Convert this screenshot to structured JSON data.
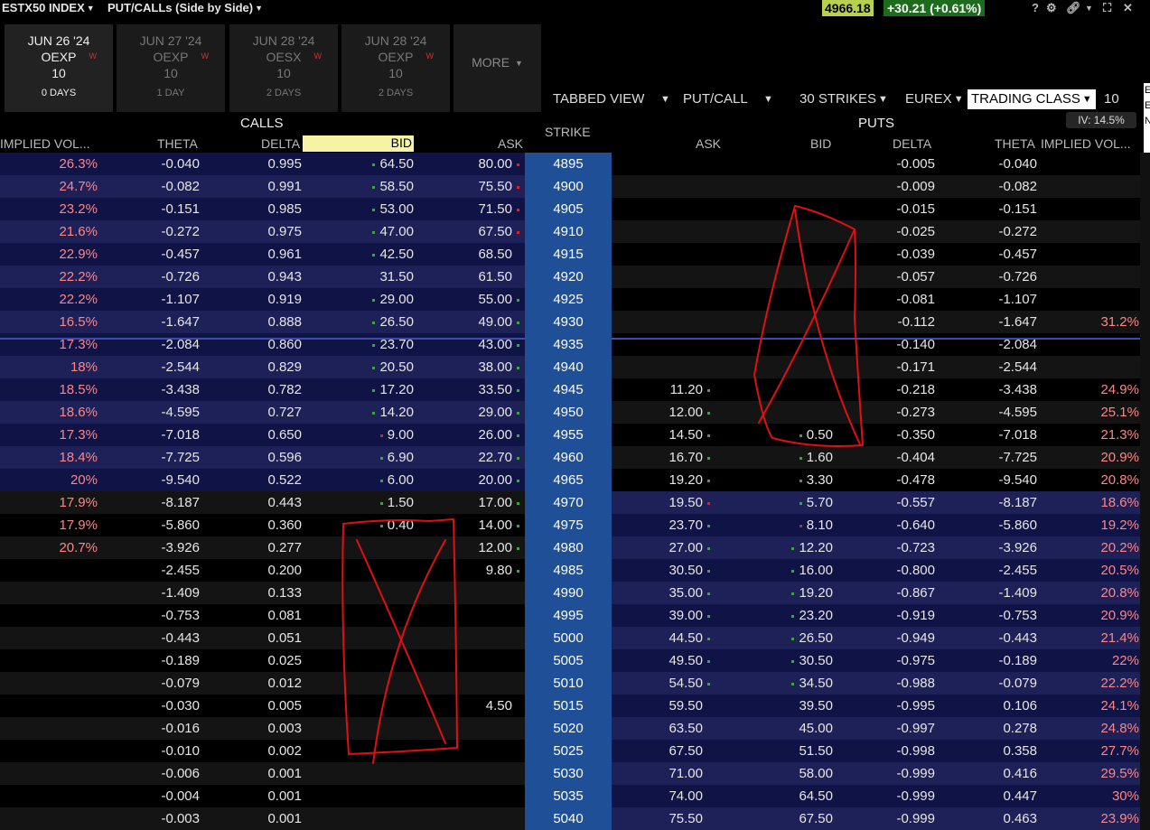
{
  "titlebar": {
    "symbol": "ESTX50 INDEX",
    "view": "PUT/CALLs (Side by Side)",
    "price": "4966.18",
    "change": "+30.21 (+0.61%)",
    "icons": [
      "help-icon",
      "gear-icon",
      "link-icon",
      "menu-caret-icon",
      "expand-icon",
      "close-icon"
    ]
  },
  "tabs": [
    {
      "date": "JUN 26 '24",
      "class": "OEXP",
      "mult": "10",
      "days": "0 DAYS",
      "flag": "W",
      "active": true
    },
    {
      "date": "JUN 27 '24",
      "class": "OEXP",
      "mult": "10",
      "days": "1 DAY",
      "flag": "W",
      "active": false
    },
    {
      "date": "JUN 28 '24",
      "class": "OESX",
      "mult": "10",
      "days": "2 DAYS",
      "flag": "W",
      "active": false
    },
    {
      "date": "JUN 28 '24",
      "class": "OEXP",
      "mult": "10",
      "days": "2 DAYS",
      "flag": "W",
      "active": false
    }
  ],
  "more_label": "MORE",
  "toolbar": {
    "view": "TABBED VIEW",
    "side": "PUT/CALL",
    "strikes": "30 STRIKES",
    "exchange": "EUREX",
    "trading_class": "TRADING CLASS",
    "multiplier": "10",
    "edge_text": "E E N"
  },
  "headers": {
    "calls": "CALLS",
    "puts": "PUTS",
    "strike": "STRIKE",
    "iv_badge": "IV: 14.5%",
    "call_cols": [
      "IMPLIED VOL...",
      "THETA",
      "DELTA",
      "BID",
      "ASK"
    ],
    "put_cols": [
      "ASK",
      "BID",
      "DELTA",
      "THETA",
      "IMPLIED VOL..."
    ]
  },
  "colors": {
    "strike_bg": "#1f4f97",
    "itm_call_a": "#101346",
    "itm_call_b": "#1d2158",
    "otm_a": "#000000",
    "otm_b": "#141414",
    "itm_put_a": "#101346",
    "itm_put_b": "#1d2158",
    "iv_text": "#ff8585",
    "annotation": "#e01010"
  },
  "rows": [
    {
      "strike": "4895",
      "c_iv": "26.3%",
      "c_theta": "-0.040",
      "c_delta": "0.995",
      "c_bid": "64.50",
      "c_bid_dot": "g",
      "c_ask": "80.00",
      "c_ask_dot": "r",
      "p_ask": "",
      "p_ask_dot": "",
      "p_bid": "",
      "p_bid_dot": "",
      "p_delta": "-0.005",
      "p_theta": "-0.040",
      "p_iv": ""
    },
    {
      "strike": "4900",
      "c_iv": "24.7%",
      "c_theta": "-0.082",
      "c_delta": "0.991",
      "c_bid": "58.50",
      "c_bid_dot": "g",
      "c_ask": "75.50",
      "c_ask_dot": "r",
      "p_ask": "",
      "p_ask_dot": "",
      "p_bid": "",
      "p_bid_dot": "",
      "p_delta": "-0.009",
      "p_theta": "-0.082",
      "p_iv": ""
    },
    {
      "strike": "4905",
      "c_iv": "23.2%",
      "c_theta": "-0.151",
      "c_delta": "0.985",
      "c_bid": "53.00",
      "c_bid_dot": "g",
      "c_ask": "71.50",
      "c_ask_dot": "r",
      "p_ask": "",
      "p_ask_dot": "",
      "p_bid": "",
      "p_bid_dot": "",
      "p_delta": "-0.015",
      "p_theta": "-0.151",
      "p_iv": ""
    },
    {
      "strike": "4910",
      "c_iv": "21.6%",
      "c_theta": "-0.272",
      "c_delta": "0.975",
      "c_bid": "47.00",
      "c_bid_dot": "g",
      "c_ask": "67.50",
      "c_ask_dot": "r",
      "p_ask": "",
      "p_ask_dot": "",
      "p_bid": "",
      "p_bid_dot": "",
      "p_delta": "-0.025",
      "p_theta": "-0.272",
      "p_iv": ""
    },
    {
      "strike": "4915",
      "c_iv": "22.9%",
      "c_theta": "-0.457",
      "c_delta": "0.961",
      "c_bid": "42.50",
      "c_bid_dot": "g",
      "c_ask": "68.50",
      "c_ask_dot": "",
      "p_ask": "",
      "p_ask_dot": "",
      "p_bid": "",
      "p_bid_dot": "",
      "p_delta": "-0.039",
      "p_theta": "-0.457",
      "p_iv": ""
    },
    {
      "strike": "4920",
      "c_iv": "22.2%",
      "c_theta": "-0.726",
      "c_delta": "0.943",
      "c_bid": "31.50",
      "c_bid_dot": "",
      "c_ask": "61.50",
      "c_ask_dot": "",
      "p_ask": "",
      "p_ask_dot": "",
      "p_bid": "",
      "p_bid_dot": "",
      "p_delta": "-0.057",
      "p_theta": "-0.726",
      "p_iv": ""
    },
    {
      "strike": "4925",
      "c_iv": "22.2%",
      "c_theta": "-1.107",
      "c_delta": "0.919",
      "c_bid": "29.00",
      "c_bid_dot": "g",
      "c_ask": "55.00",
      "c_ask_dot": "g",
      "p_ask": "",
      "p_ask_dot": "",
      "p_bid": "",
      "p_bid_dot": "",
      "p_delta": "-0.081",
      "p_theta": "-1.107",
      "p_iv": ""
    },
    {
      "strike": "4930",
      "c_iv": "16.5%",
      "c_theta": "-1.647",
      "c_delta": "0.888",
      "c_bid": "26.50",
      "c_bid_dot": "g",
      "c_ask": "49.00",
      "c_ask_dot": "g",
      "p_ask": "",
      "p_ask_dot": "",
      "p_bid": "",
      "p_bid_dot": "",
      "p_delta": "-0.112",
      "p_theta": "-1.647",
      "p_iv": "31.2%"
    },
    {
      "strike": "4935",
      "c_iv": "17.3%",
      "c_theta": "-2.084",
      "c_delta": "0.860",
      "c_bid": "23.70",
      "c_bid_dot": "g",
      "c_ask": "43.00",
      "c_ask_dot": "g",
      "p_ask": "",
      "p_ask_dot": "",
      "p_bid": "",
      "p_bid_dot": "",
      "p_delta": "-0.140",
      "p_theta": "-2.084",
      "p_iv": ""
    },
    {
      "strike": "4940",
      "c_iv": "18%",
      "c_theta": "-2.544",
      "c_delta": "0.829",
      "c_bid": "20.50",
      "c_bid_dot": "g",
      "c_ask": "38.00",
      "c_ask_dot": "g",
      "p_ask": "",
      "p_ask_dot": "",
      "p_bid": "",
      "p_bid_dot": "",
      "p_delta": "-0.171",
      "p_theta": "-2.544",
      "p_iv": ""
    },
    {
      "strike": "4945",
      "c_iv": "18.5%",
      "c_theta": "-3.438",
      "c_delta": "0.782",
      "c_bid": "17.20",
      "c_bid_dot": "g",
      "c_ask": "33.50",
      "c_ask_dot": "g",
      "p_ask": "11.20",
      "p_ask_dot": "g",
      "p_bid": "",
      "p_bid_dot": "",
      "p_delta": "-0.218",
      "p_theta": "-3.438",
      "p_iv": "24.9%"
    },
    {
      "strike": "4950",
      "c_iv": "18.6%",
      "c_theta": "-4.595",
      "c_delta": "0.727",
      "c_bid": "14.20",
      "c_bid_dot": "g",
      "c_ask": "29.00",
      "c_ask_dot": "g",
      "p_ask": "12.00",
      "p_ask_dot": "g",
      "p_bid": "",
      "p_bid_dot": "",
      "p_delta": "-0.273",
      "p_theta": "-4.595",
      "p_iv": "25.1%"
    },
    {
      "strike": "4955",
      "c_iv": "17.3%",
      "c_theta": "-7.018",
      "c_delta": "0.650",
      "c_bid": "9.00",
      "c_bid_dot": "r",
      "c_ask": "26.00",
      "c_ask_dot": "g",
      "p_ask": "14.50",
      "p_ask_dot": "g",
      "p_bid": "0.50",
      "p_bid_dot": "g",
      "p_delta": "-0.350",
      "p_theta": "-7.018",
      "p_iv": "21.3%"
    },
    {
      "strike": "4960",
      "c_iv": "18.4%",
      "c_theta": "-7.725",
      "c_delta": "0.596",
      "c_bid": "6.90",
      "c_bid_dot": "g",
      "c_ask": "22.70",
      "c_ask_dot": "g",
      "p_ask": "16.70",
      "p_ask_dot": "g",
      "p_bid": "1.60",
      "p_bid_dot": "g",
      "p_delta": "-0.404",
      "p_theta": "-7.725",
      "p_iv": "20.9%"
    },
    {
      "strike": "4965",
      "c_iv": "20%",
      "c_theta": "-9.540",
      "c_delta": "0.522",
      "c_bid": "6.00",
      "c_bid_dot": "g",
      "c_ask": "20.00",
      "c_ask_dot": "g",
      "p_ask": "19.20",
      "p_ask_dot": "g",
      "p_bid": "3.30",
      "p_bid_dot": "g",
      "p_delta": "-0.478",
      "p_theta": "-9.540",
      "p_iv": "20.8%"
    },
    {
      "strike": "4970",
      "c_iv": "17.9%",
      "c_theta": "-8.187",
      "c_delta": "0.443",
      "c_bid": "1.50",
      "c_bid_dot": "g",
      "c_ask": "17.00",
      "c_ask_dot": "g",
      "p_ask": "19.50",
      "p_ask_dot": "r",
      "p_bid": "5.70",
      "p_bid_dot": "g",
      "p_delta": "-0.557",
      "p_theta": "-8.187",
      "p_iv": "18.6%"
    },
    {
      "strike": "4975",
      "c_iv": "17.9%",
      "c_theta": "-5.860",
      "c_delta": "0.360",
      "c_bid": "0.40",
      "c_bid_dot": "g",
      "c_ask": "14.00",
      "c_ask_dot": "g",
      "p_ask": "23.70",
      "p_ask_dot": "g",
      "p_bid": "8.10",
      "p_bid_dot": "r",
      "p_delta": "-0.640",
      "p_theta": "-5.860",
      "p_iv": "19.2%"
    },
    {
      "strike": "4980",
      "c_iv": "20.7%",
      "c_theta": "-3.926",
      "c_delta": "0.277",
      "c_bid": "",
      "c_bid_dot": "",
      "c_ask": "12.00",
      "c_ask_dot": "g",
      "p_ask": "27.00",
      "p_ask_dot": "g",
      "p_bid": "12.20",
      "p_bid_dot": "g",
      "p_delta": "-0.723",
      "p_theta": "-3.926",
      "p_iv": "20.2%"
    },
    {
      "strike": "4985",
      "c_iv": "",
      "c_theta": "-2.455",
      "c_delta": "0.200",
      "c_bid": "",
      "c_bid_dot": "",
      "c_ask": "9.80",
      "c_ask_dot": "g",
      "p_ask": "30.50",
      "p_ask_dot": "g",
      "p_bid": "16.00",
      "p_bid_dot": "g",
      "p_delta": "-0.800",
      "p_theta": "-2.455",
      "p_iv": "20.5%"
    },
    {
      "strike": "4990",
      "c_iv": "",
      "c_theta": "-1.409",
      "c_delta": "0.133",
      "c_bid": "",
      "c_bid_dot": "",
      "c_ask": "",
      "c_ask_dot": "",
      "p_ask": "35.00",
      "p_ask_dot": "g",
      "p_bid": "19.20",
      "p_bid_dot": "g",
      "p_delta": "-0.867",
      "p_theta": "-1.409",
      "p_iv": "20.8%"
    },
    {
      "strike": "4995",
      "c_iv": "",
      "c_theta": "-0.753",
      "c_delta": "0.081",
      "c_bid": "",
      "c_bid_dot": "",
      "c_ask": "",
      "c_ask_dot": "",
      "p_ask": "39.00",
      "p_ask_dot": "g",
      "p_bid": "23.20",
      "p_bid_dot": "g",
      "p_delta": "-0.919",
      "p_theta": "-0.753",
      "p_iv": "20.9%"
    },
    {
      "strike": "5000",
      "c_iv": "",
      "c_theta": "-0.443",
      "c_delta": "0.051",
      "c_bid": "",
      "c_bid_dot": "",
      "c_ask": "",
      "c_ask_dot": "",
      "p_ask": "44.50",
      "p_ask_dot": "g",
      "p_bid": "26.50",
      "p_bid_dot": "g",
      "p_delta": "-0.949",
      "p_theta": "-0.443",
      "p_iv": "21.4%"
    },
    {
      "strike": "5005",
      "c_iv": "",
      "c_theta": "-0.189",
      "c_delta": "0.025",
      "c_bid": "",
      "c_bid_dot": "",
      "c_ask": "",
      "c_ask_dot": "",
      "p_ask": "49.50",
      "p_ask_dot": "g",
      "p_bid": "30.50",
      "p_bid_dot": "g",
      "p_delta": "-0.975",
      "p_theta": "-0.189",
      "p_iv": "22%"
    },
    {
      "strike": "5010",
      "c_iv": "",
      "c_theta": "-0.079",
      "c_delta": "0.012",
      "c_bid": "",
      "c_bid_dot": "",
      "c_ask": "",
      "c_ask_dot": "",
      "p_ask": "54.50",
      "p_ask_dot": "g",
      "p_bid": "34.50",
      "p_bid_dot": "g",
      "p_delta": "-0.988",
      "p_theta": "-0.079",
      "p_iv": "22.2%"
    },
    {
      "strike": "5015",
      "c_iv": "",
      "c_theta": "-0.030",
      "c_delta": "0.005",
      "c_bid": "",
      "c_bid_dot": "",
      "c_ask": "4.50",
      "c_ask_dot": "",
      "p_ask": "59.50",
      "p_ask_dot": "",
      "p_bid": "39.50",
      "p_bid_dot": "",
      "p_delta": "-0.995",
      "p_theta": "0.106",
      "p_iv": "24.1%"
    },
    {
      "strike": "5020",
      "c_iv": "",
      "c_theta": "-0.016",
      "c_delta": "0.003",
      "c_bid": "",
      "c_bid_dot": "",
      "c_ask": "",
      "c_ask_dot": "",
      "p_ask": "63.50",
      "p_ask_dot": "",
      "p_bid": "45.00",
      "p_bid_dot": "",
      "p_delta": "-0.997",
      "p_theta": "0.278",
      "p_iv": "24.8%"
    },
    {
      "strike": "5025",
      "c_iv": "",
      "c_theta": "-0.010",
      "c_delta": "0.002",
      "c_bid": "",
      "c_bid_dot": "",
      "c_ask": "",
      "c_ask_dot": "",
      "p_ask": "67.50",
      "p_ask_dot": "",
      "p_bid": "51.50",
      "p_bid_dot": "",
      "p_delta": "-0.998",
      "p_theta": "0.358",
      "p_iv": "27.7%"
    },
    {
      "strike": "5030",
      "c_iv": "",
      "c_theta": "-0.006",
      "c_delta": "0.001",
      "c_bid": "",
      "c_bid_dot": "",
      "c_ask": "",
      "c_ask_dot": "",
      "p_ask": "71.00",
      "p_ask_dot": "",
      "p_bid": "58.00",
      "p_bid_dot": "",
      "p_delta": "-0.999",
      "p_theta": "0.416",
      "p_iv": "29.5%"
    },
    {
      "strike": "5035",
      "c_iv": "",
      "c_theta": "-0.004",
      "c_delta": "0.001",
      "c_bid": "",
      "c_bid_dot": "",
      "c_ask": "",
      "c_ask_dot": "",
      "p_ask": "74.00",
      "p_ask_dot": "",
      "p_bid": "64.50",
      "p_bid_dot": "",
      "p_delta": "-0.999",
      "p_theta": "0.447",
      "p_iv": "30%"
    },
    {
      "strike": "5040",
      "c_iv": "",
      "c_theta": "-0.003",
      "c_delta": "0.001",
      "c_bid": "",
      "c_bid_dot": "",
      "c_ask": "",
      "c_ask_dot": "",
      "p_ask": "75.50",
      "p_ask_dot": "",
      "p_bid": "67.50",
      "p_bid_dot": "",
      "p_delta": "-0.999",
      "p_theta": "0.463",
      "p_iv": "23.9%"
    }
  ]
}
